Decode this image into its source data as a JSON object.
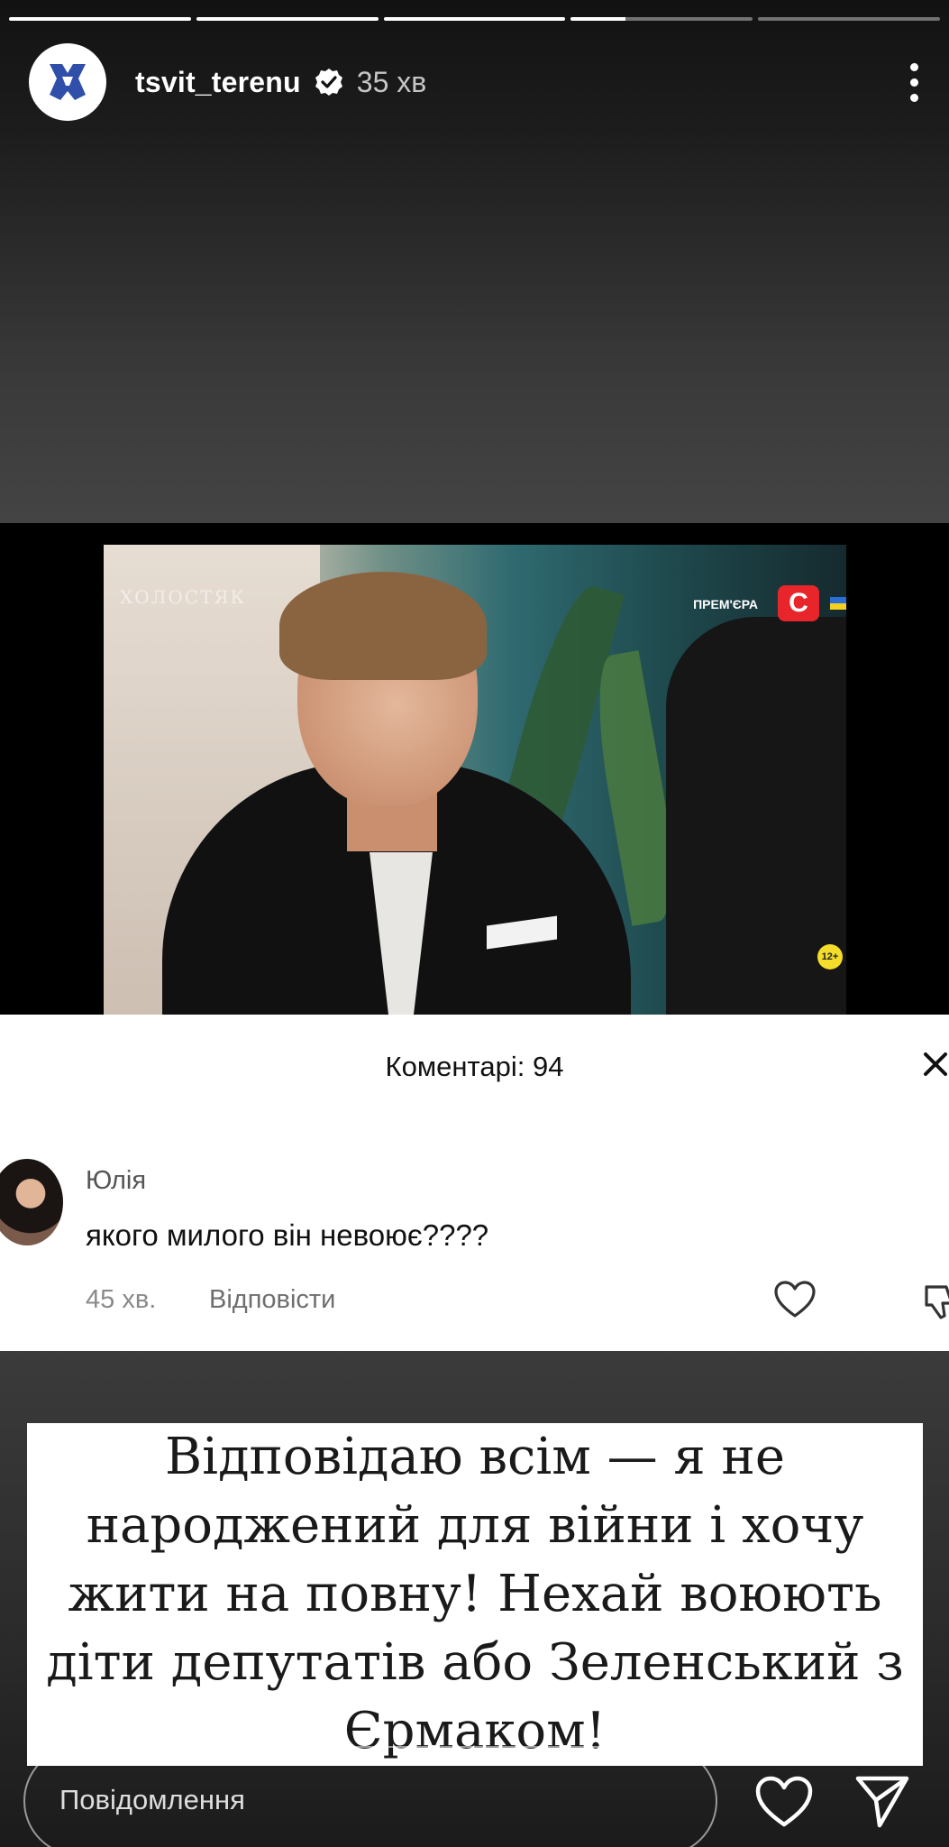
{
  "progress": [
    1.0,
    1.0,
    1.0,
    0.3,
    0.0
  ],
  "header": {
    "username": "tsvit_terenu",
    "time": "35 хв"
  },
  "video": {
    "show_logo": "ХОЛОСТЯК",
    "premiere_label": "ПРЕМ'ЄРА",
    "channel_logo": "С",
    "age_rating": "12+"
  },
  "comments": {
    "title": "Коментарі: 94",
    "item": {
      "author": "Юлія",
      "text": "якого милого він невоює????",
      "time": "45 хв.",
      "reply_label": "Відповісти"
    }
  },
  "statement": {
    "text": "Відповідаю всім — я не народжений для війни і хочу жити на повну! Нехай воюють діти депутатів або Зеленський з Єрмаком!"
  },
  "message_bar": {
    "placeholder": "Повідомлення"
  },
  "colors": {
    "verified": "#ffffff",
    "brand_red": "#e8252b"
  }
}
